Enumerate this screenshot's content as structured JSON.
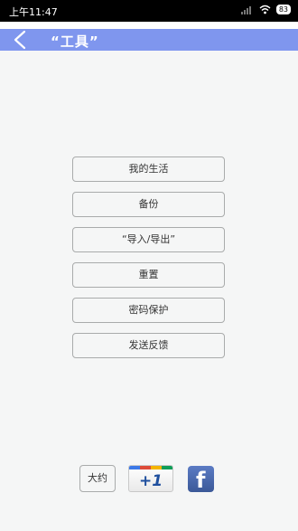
{
  "status_bar": {
    "time": "上午11:47",
    "battery": "83"
  },
  "header": {
    "title": "“工具”",
    "back_icon": "chevron-left-icon"
  },
  "menu": {
    "items": [
      {
        "label": "我的生活"
      },
      {
        "label": "备份"
      },
      {
        "label": "“导入/导出”"
      },
      {
        "label": "重置"
      },
      {
        "label": "密码保护"
      },
      {
        "label": "发送反馈"
      }
    ]
  },
  "footer": {
    "about_label": "大约",
    "gplus_label": "+1",
    "facebook_label": "f"
  },
  "colors": {
    "title_bar": "#7f96ee",
    "status_bar": "#000000",
    "background": "#f5f6f6",
    "button_border": "#a9abab",
    "facebook": "#3b5998"
  }
}
